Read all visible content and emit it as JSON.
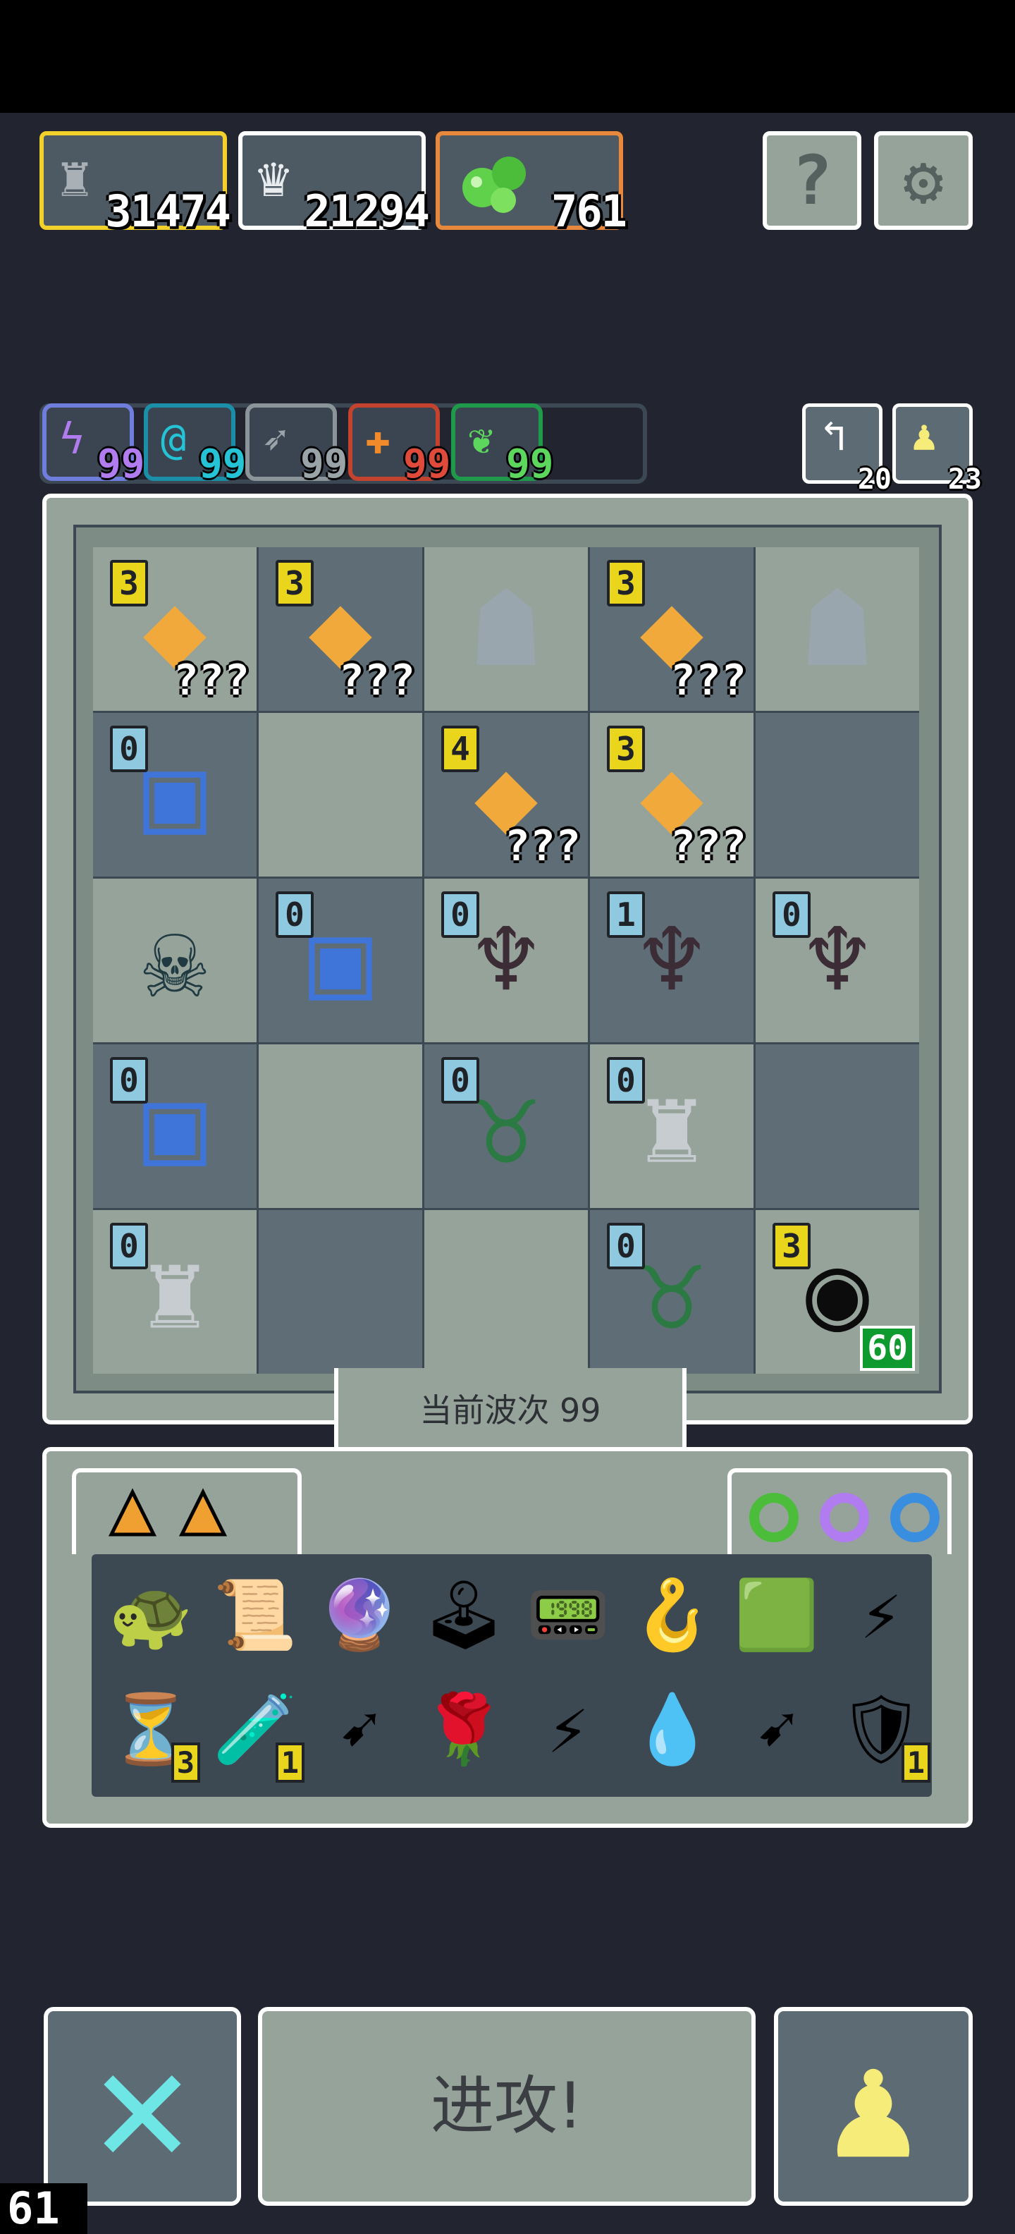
{
  "resources": [
    {
      "icon": "knight-helmet-icon",
      "value": "31474",
      "border": "#f2d12a"
    },
    {
      "icon": "trophy-podium-icon",
      "value": "21294",
      "border": "#ffffff"
    },
    {
      "icon": "green-slime-icon",
      "value": "761",
      "border": "#e8883c"
    }
  ],
  "top_buttons": {
    "help_glyph": "?",
    "settings_glyph": "⚙"
  },
  "stats": [
    {
      "icon": "lightning-icon",
      "glyph": "ϟ",
      "value": "99",
      "color": "#b17cf0"
    },
    {
      "icon": "swirl-icon",
      "glyph": "@",
      "value": "99",
      "color": "#24c4d6"
    },
    {
      "icon": "arrow-icon",
      "glyph": "➶",
      "value": "99",
      "color": "#9aa3a8"
    },
    {
      "icon": "fire-icon",
      "glyph": "✚",
      "value": "99",
      "color": "#e04a3a"
    },
    {
      "icon": "leaf-icon",
      "glyph": "❦",
      "value": "99",
      "color": "#5cd65c"
    }
  ],
  "mini_buttons": [
    {
      "icon": "undo-arrow-icon",
      "glyph": "↰",
      "value": "20"
    },
    {
      "icon": "pawn-icon",
      "glyph": "♟",
      "value": "23"
    }
  ],
  "board": [
    [
      {
        "u": "crystal",
        "lv": "3",
        "q": "???"
      },
      {
        "u": "crystal",
        "lv": "3",
        "q": "???"
      },
      {
        "u": "stone-golem"
      },
      {
        "u": "crystal",
        "lv": "3",
        "q": "???"
      },
      {
        "u": "stone-golem"
      }
    ],
    [
      {
        "u": "blue-portal",
        "lv": "0"
      },
      {
        "u": ""
      },
      {
        "u": "crystal-small",
        "lv": "4",
        "q": "???"
      },
      {
        "u": "crystal",
        "lv": "3",
        "q": "???"
      },
      {
        "u": ""
      }
    ],
    [
      {
        "u": "dark-tentacle"
      },
      {
        "u": "blue-portal",
        "lv": "0"
      },
      {
        "u": "demon-girl",
        "lv": "0"
      },
      {
        "u": "demon-girl",
        "lv": "1"
      },
      {
        "u": "demon-girl",
        "lv": "0"
      }
    ],
    [
      {
        "u": "blue-portal",
        "lv": "0"
      },
      {
        "u": ""
      },
      {
        "u": "minotaur",
        "lv": "0"
      },
      {
        "u": "armored-knight",
        "lv": "0"
      },
      {
        "u": ""
      }
    ],
    [
      {
        "u": "armored-knight",
        "lv": "0"
      },
      {
        "u": ""
      },
      {
        "u": ""
      },
      {
        "u": "minotaur",
        "lv": "0"
      },
      {
        "u": "black-hole-spawner",
        "lv": "3",
        "timer": "60"
      }
    ]
  ],
  "wave_label": "当前波次 99",
  "inventory": {
    "card_icons": [
      "orange-triangle-card-icon",
      "orange-triangle-card-icon"
    ],
    "ring_icons": [
      "green-ring-icon",
      "purple-ring-icon",
      "blue-ring-icon"
    ],
    "row1": [
      {
        "icon": "green-turtle-shell-icon",
        "glyph": "🐢"
      },
      {
        "icon": "torn-scroll-icon",
        "glyph": "📜"
      },
      {
        "icon": "blue-orb-crown-icon",
        "glyph": "🔮"
      },
      {
        "icon": "joystick-icon",
        "glyph": "🕹"
      },
      {
        "icon": "gameboy-icon",
        "glyph": "📟"
      },
      {
        "icon": "orange-hook-icon",
        "glyph": "🪝"
      },
      {
        "icon": "green-tile-icon",
        "glyph": "🟩"
      },
      {
        "icon": "blue-lightning-icon",
        "glyph": "⚡"
      }
    ],
    "row2": [
      {
        "icon": "hourglass-icon",
        "glyph": "⏳",
        "count": "3"
      },
      {
        "icon": "potion-jar-icon",
        "glyph": "🧪",
        "count": "1"
      },
      {
        "icon": "pink-arrow-icon",
        "glyph": "➹"
      },
      {
        "icon": "red-rose-tile-icon",
        "glyph": "🌹"
      },
      {
        "icon": "purple-lightning-icon",
        "glyph": "⚡"
      },
      {
        "icon": "blue-water-drop-icon",
        "glyph": "💧"
      },
      {
        "icon": "green-arrow-icon",
        "glyph": "➹"
      },
      {
        "icon": "red-shield-icon",
        "glyph": "🛡",
        "count": "1"
      }
    ]
  },
  "bottom": {
    "close_glyph": "✕",
    "attack_label": "进攻!",
    "pawn_glyph": "♟"
  },
  "fps": "61",
  "colors": {
    "panel": "#96a39b",
    "dark_cell": "#5f6e76",
    "background": "#22252f",
    "accent_yellow": "#e8d51c"
  }
}
